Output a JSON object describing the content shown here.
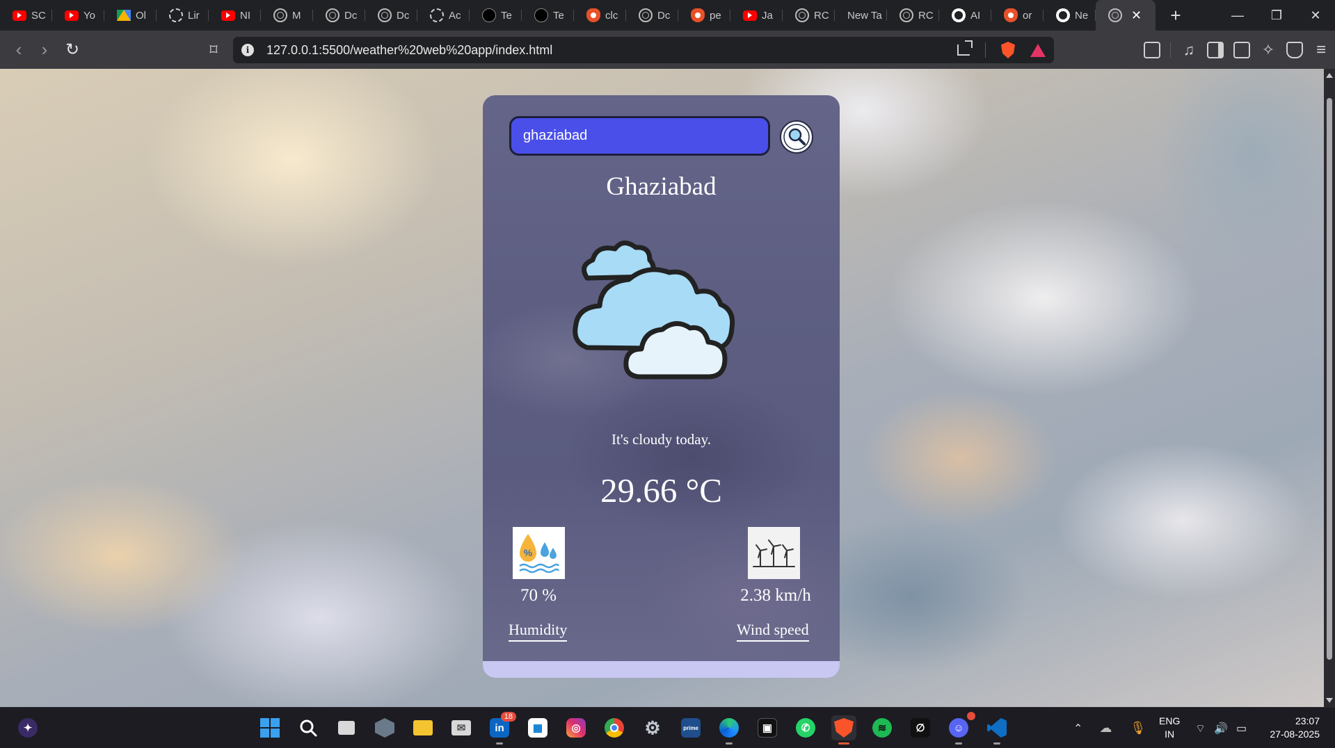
{
  "browser": {
    "tabs": [
      {
        "label": "SC",
        "icon": "youtube-icon"
      },
      {
        "label": "Yo",
        "icon": "youtube-icon"
      },
      {
        "label": "Ol",
        "icon": "google-drive-icon"
      },
      {
        "label": "Lir",
        "icon": "chatgpt-icon"
      },
      {
        "label": "NI",
        "icon": "youtube-icon"
      },
      {
        "label": "M",
        "icon": "globe-icon"
      },
      {
        "label": "Dc",
        "icon": "globe-icon"
      },
      {
        "label": "Dc",
        "icon": "globe-icon"
      },
      {
        "label": "Ac",
        "icon": "chatgpt-icon"
      },
      {
        "label": "Te",
        "icon": "te-icon"
      },
      {
        "label": "Te",
        "icon": "te-icon"
      },
      {
        "label": "clc",
        "icon": "brave-icon"
      },
      {
        "label": "Dc",
        "icon": "globe-icon"
      },
      {
        "label": "pe",
        "icon": "brave-icon"
      },
      {
        "label": "Ja",
        "icon": "youtube-icon"
      },
      {
        "label": "RC",
        "icon": "globe-icon"
      },
      {
        "label": "New Ta",
        "icon": ""
      },
      {
        "label": "RC",
        "icon": "globe-icon"
      },
      {
        "label": "AI",
        "icon": "github-icon"
      },
      {
        "label": "or",
        "icon": "brave-icon"
      },
      {
        "label": "Ne",
        "icon": "github-icon"
      }
    ],
    "active_tab_icon": "globe-icon",
    "url": "127.0.0.1:5500/weather%20web%20app/index.html"
  },
  "weather": {
    "search_value": "ghaziabad",
    "city": "Ghaziabad",
    "description": "It's cloudy today.",
    "temperature": "29.66 °C",
    "humidity_value": "70 %",
    "humidity_label": "Humidity",
    "wind_value": "2.38 km/h",
    "wind_label": "Wind speed",
    "colors": {
      "input_bg": "#4a4fe9",
      "card_bottom": "#c9c8f3",
      "cloud_light": "#a8dbf5",
      "cloud_white": "#e6f3fb"
    }
  },
  "taskbar": {
    "lang": "ENG",
    "region": "IN",
    "time": "23:07",
    "date": "27-08-2025",
    "linkedin_badge": "18"
  }
}
